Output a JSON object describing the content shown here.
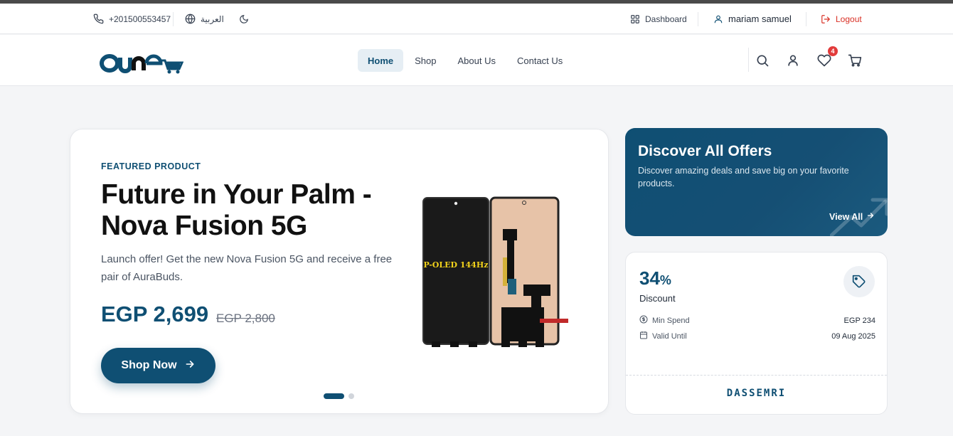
{
  "topbar": {
    "phone": "+201500553457",
    "language": "العربية",
    "dashboard": "Dashboard",
    "user_name": "mariam samuel",
    "logout": "Logout"
  },
  "header": {
    "nav": [
      "Home",
      "Shop",
      "About Us",
      "Contact Us"
    ],
    "active_nav": "Home",
    "wishlist_count": "4"
  },
  "hero": {
    "eyebrow": "FEATURED PRODUCT",
    "title": "Future in Your Palm - Nova Fusion 5G",
    "description": "Launch offer! Get the new Nova Fusion 5G and receive a free pair of AuraBuds.",
    "price": "EGP 2,699",
    "old_price": "EGP 2,800",
    "cta": "Shop Now",
    "image_text": "P-OLED 144Hz",
    "slides_total": 2,
    "slide_active": 1
  },
  "offers": {
    "title": "Discover All Offers",
    "description": "Discover amazing deals and save big on your favorite products.",
    "link": "View All"
  },
  "coupon": {
    "percent": "34",
    "percent_symbol": "%",
    "label": "Discount",
    "min_spend_label": "Min Spend",
    "min_spend_value": "EGP 234",
    "valid_until_label": "Valid Until",
    "valid_until_value": "09 Aug 2025",
    "code": "DASSEMRI"
  },
  "colors": {
    "brand": "#0f4f73",
    "logout": "#d93025",
    "badge": "#e23b3b"
  }
}
